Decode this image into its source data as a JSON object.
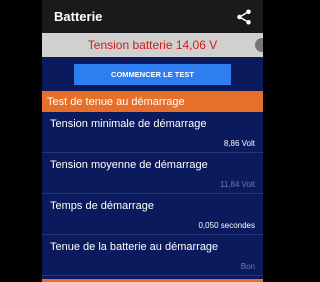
{
  "appbar": {
    "title": "Batterie",
    "share_icon": "share-icon"
  },
  "voltage": {
    "text": "Tension batterie 14,06 V",
    "color": "#d61a1a"
  },
  "action": {
    "start_test_label": "COMMENCER LE TEST"
  },
  "section": {
    "title": "Test de tenue au démarrage"
  },
  "rows": [
    {
      "label": "Tension minimale de démarrage",
      "value": "8,86 Volt"
    },
    {
      "label": "Tension moyenne de démarrage",
      "value": "11,84 Volt"
    },
    {
      "label": "Temps de démarrage",
      "value": "0,050 secondes"
    },
    {
      "label": "Tenue de la batterie au démarrage",
      "value": "Bon"
    }
  ],
  "colors": {
    "accent": "#e6702a",
    "button": "#2f7ef0",
    "background": "#0a1a5c"
  }
}
